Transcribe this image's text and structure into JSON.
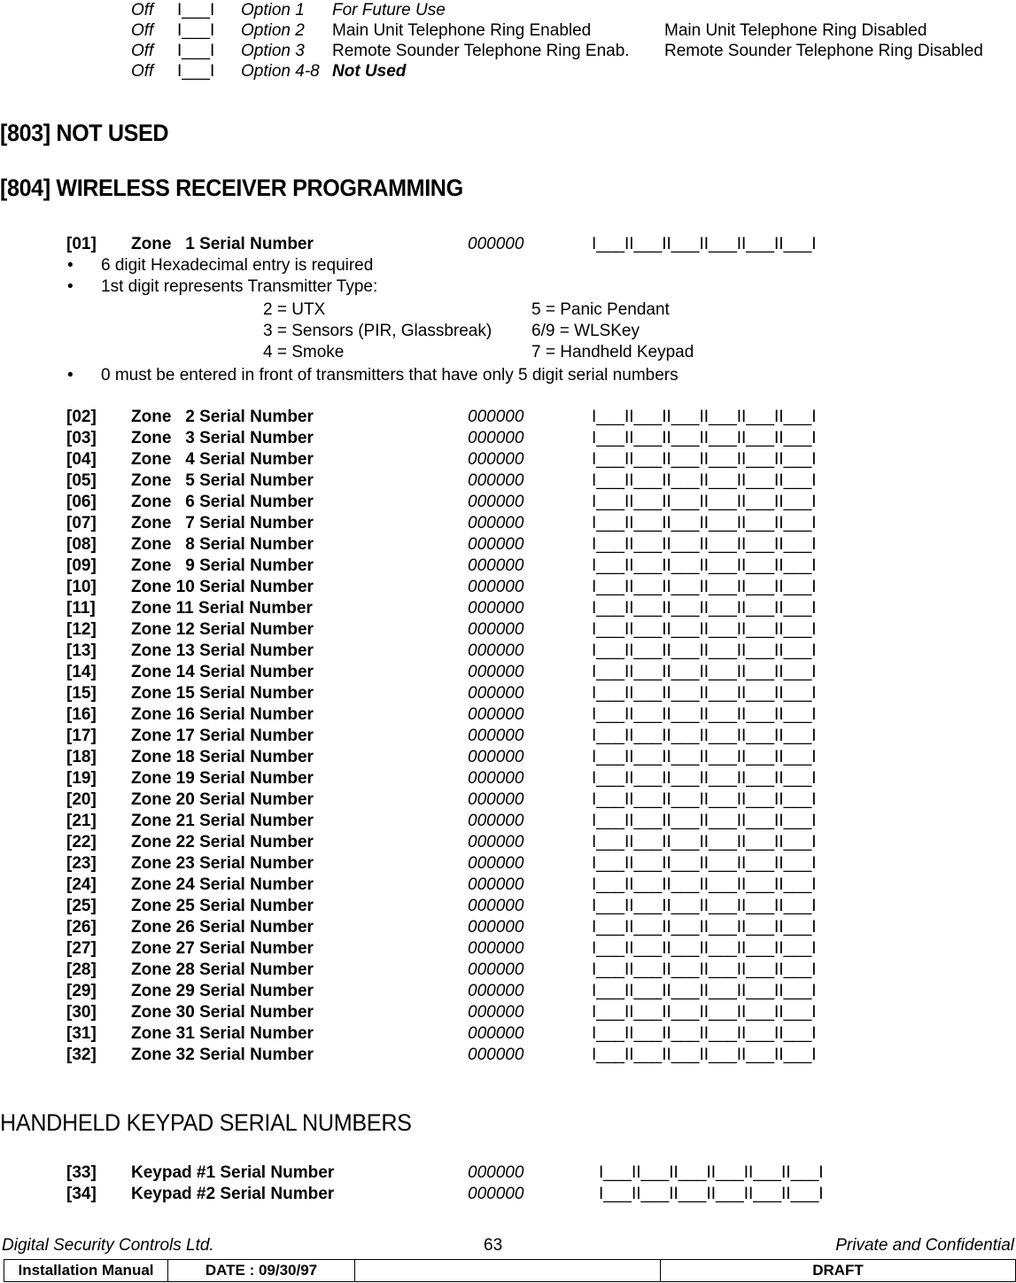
{
  "options_block": {
    "rows": [
      {
        "state": "Off",
        "box": "I___I",
        "option": "Option 1",
        "desc1": "For Future Use",
        "desc2": "",
        "option_italic": true,
        "desc1_style": "italic"
      },
      {
        "state": "Off",
        "box": "I___I",
        "option": "Option 2",
        "desc1": "Main Unit Telephone Ring Enabled",
        "desc2": "Main Unit Telephone Ring Disabled",
        "option_italic": true,
        "desc1_style": "normal"
      },
      {
        "state": "Off",
        "box": "I___I",
        "option": "Option 3",
        "desc1": "Remote Sounder Telephone Ring Enab.",
        "desc2": "Remote Sounder Telephone Ring Disabled",
        "option_italic": true,
        "desc1_style": "normal"
      },
      {
        "state": "Off",
        "box": "I___I",
        "option": "Option 4-8",
        "desc1": "Not Used",
        "desc2": "",
        "option_italic": true,
        "desc1_style": "bold-italic"
      }
    ]
  },
  "heading_803": "[803] NOT USED",
  "heading_804": "[804] WIRELESS RECEIVER PROGRAMMING",
  "heading_keypads": "HANDHELD KEYPAD SERIAL NUMBERS",
  "serial_box_pattern": "I___II___II___II___II___II___I",
  "zone_one": {
    "index": "[01]",
    "label": "Zone   1 Serial Number",
    "default": "000000",
    "boxes": "I___II___II___II___II___II___I"
  },
  "notes": {
    "bullets": [
      {
        "dot": "•",
        "text": "6 digit Hexadecimal entry is required"
      },
      {
        "dot": "•",
        "text": "1st digit represents Transmitter Type:"
      },
      {
        "dot": "•",
        "text": "0 must be entered in front of transmitters that have only 5 digit serial numbers"
      }
    ],
    "transmitter_types": [
      {
        "col1": "2 = UTX",
        "col2": "5 = Panic Pendant"
      },
      {
        "col1": "3 = Sensors (PIR, Glassbreak)",
        "col2": "6/9 = WLSKey"
      },
      {
        "col1": "4 = Smoke",
        "col2": "7 = Handheld Keypad"
      }
    ]
  },
  "zone_rows": [
    {
      "index": "[02]",
      "label": "Zone   2 Serial Number",
      "default": "000000",
      "boxes": "I___II___II___II___II___II___I"
    },
    {
      "index": "[03]",
      "label": "Zone   3 Serial Number",
      "default": "000000",
      "boxes": "I___II___II___II___II___II___I"
    },
    {
      "index": "[04]",
      "label": "Zone   4 Serial Number",
      "default": "000000",
      "boxes": "I___II___II___II___II___II___I"
    },
    {
      "index": "[05]",
      "label": "Zone   5 Serial Number",
      "default": "000000",
      "boxes": "I___II___II___II___II___II___I"
    },
    {
      "index": "[06]",
      "label": "Zone   6 Serial Number",
      "default": "000000",
      "boxes": "I___II___II___II___II___II___I"
    },
    {
      "index": "[07]",
      "label": "Zone   7 Serial Number",
      "default": "000000",
      "boxes": "I___II___II___II___II___II___I"
    },
    {
      "index": "[08]",
      "label": "Zone   8 Serial Number",
      "default": "000000",
      "boxes": "I___II___II___II___II___II___I"
    },
    {
      "index": "[09]",
      "label": "Zone   9 Serial Number",
      "default": "000000",
      "boxes": "I___II___II___II___II___II___I"
    },
    {
      "index": "[10]",
      "label": "Zone 10 Serial Number",
      "default": "000000",
      "boxes": "I___II___II___II___II___II___I"
    },
    {
      "index": "[11]",
      "label": "Zone 11 Serial Number",
      "default": "000000",
      "boxes": "I___II___II___II___II___II___I"
    },
    {
      "index": "[12]",
      "label": "Zone 12 Serial Number",
      "default": "000000",
      "boxes": "I___II___II___II___II___II___I"
    },
    {
      "index": "[13]",
      "label": "Zone 13 Serial Number",
      "default": "000000",
      "boxes": "I___II___II___II___II___II___I"
    },
    {
      "index": "[14]",
      "label": "Zone 14 Serial Number",
      "default": "000000",
      "boxes": "I___II___II___II___II___II___I"
    },
    {
      "index": "[15]",
      "label": "Zone 15 Serial Number",
      "default": "000000",
      "boxes": "I___II___II___II___II___II___I"
    },
    {
      "index": "[16]",
      "label": "Zone 16 Serial Number",
      "default": "000000",
      "boxes": "I___II___II___II___II___II___I"
    },
    {
      "index": "[17]",
      "label": "Zone 17 Serial Number",
      "default": "000000",
      "boxes": "I___II___II___II___II___II___I"
    },
    {
      "index": "[18]",
      "label": "Zone 18 Serial Number",
      "default": "000000",
      "boxes": "I___II___II___II___II___II___I"
    },
    {
      "index": "[19]",
      "label": "Zone 19 Serial Number",
      "default": "000000",
      "boxes": "I___II___II___II___II___II___I"
    },
    {
      "index": "[20]",
      "label": "Zone 20 Serial Number",
      "default": "000000",
      "boxes": "I___II___II___II___II___II___I"
    },
    {
      "index": "[21]",
      "label": "Zone 21 Serial Number",
      "default": "000000",
      "boxes": "I___II___II___II___II___II___I"
    },
    {
      "index": "[22]",
      "label": "Zone 22 Serial Number",
      "default": "000000",
      "boxes": "I___II___II___II___II___II___I"
    },
    {
      "index": "[23]",
      "label": "Zone 23 Serial Number",
      "default": "000000",
      "boxes": "I___II___II___II___II___II___I"
    },
    {
      "index": "[24]",
      "label": "Zone 24 Serial Number",
      "default": "000000",
      "boxes": "I___II___II___II___II___II___I"
    },
    {
      "index": "[25]",
      "label": "Zone 25 Serial Number",
      "default": "000000",
      "boxes": "I___II___II___II___II___II___I"
    },
    {
      "index": "[26]",
      "label": "Zone 26 Serial Number",
      "default": "000000",
      "boxes": "I___II___II___II___II___II___I"
    },
    {
      "index": "[27]",
      "label": "Zone 27 Serial Number",
      "default": "000000",
      "boxes": "I___II___II___II___II___II___I"
    },
    {
      "index": "[28]",
      "label": "Zone 28 Serial Number",
      "default": "000000",
      "boxes": "I___II___II___II___II___II___I"
    },
    {
      "index": "[29]",
      "label": "Zone 29 Serial Number",
      "default": "000000",
      "boxes": "I___II___II___II___II___II___I"
    },
    {
      "index": "[30]",
      "label": "Zone 30 Serial Number",
      "default": "000000",
      "boxes": "I___II___II___II___II___II___I"
    },
    {
      "index": "[31]",
      "label": "Zone 31 Serial Number",
      "default": "000000",
      "boxes": "I___II___II___II___II___II___I"
    },
    {
      "index": "[32]",
      "label": "Zone 32 Serial Number",
      "default": "000000",
      "boxes": "I___II___II___II___II___II___I"
    }
  ],
  "keypad_rows": [
    {
      "index": "[33]",
      "label": "Keypad #1 Serial Number",
      "default": "000000",
      "boxes": "I___II___II___II___II___II___I"
    },
    {
      "index": "[34]",
      "label": "Keypad #2 Serial Number",
      "default": "000000",
      "boxes": "I___II___II___II___II___II___I"
    }
  ],
  "footer": {
    "company": "Digital Security Controls Ltd.",
    "page_number": "63",
    "confidentiality": "Private and Confidential",
    "table": {
      "manual": "Installation Manual",
      "date": "DATE :  09/30/97",
      "blank": "",
      "status": "DRAFT"
    }
  }
}
